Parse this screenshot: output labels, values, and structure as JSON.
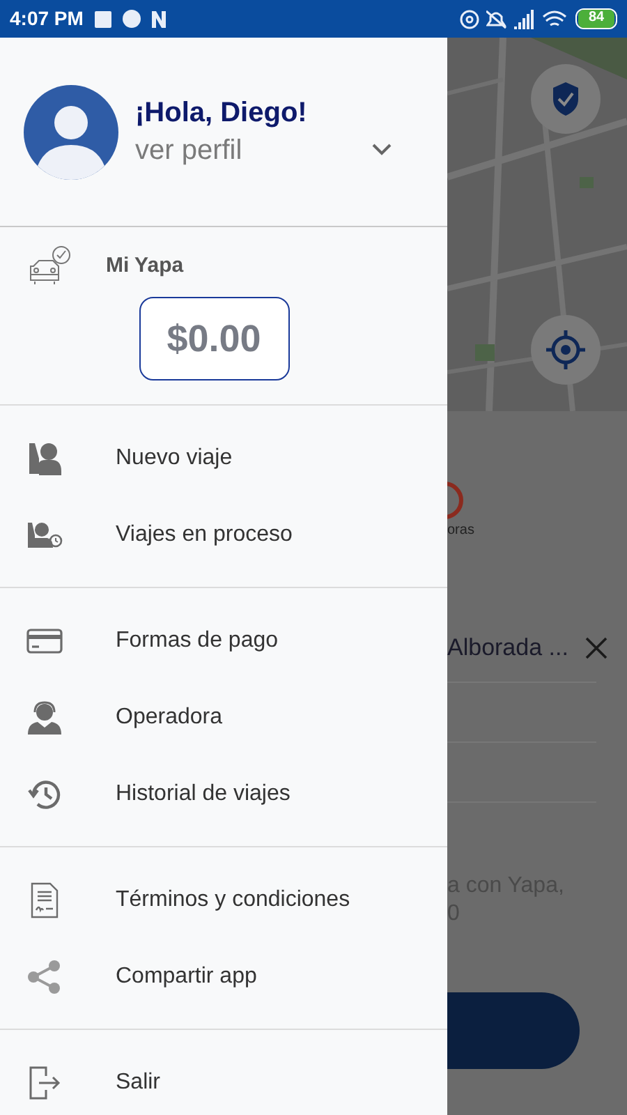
{
  "status_bar": {
    "time": "4:07 PM",
    "battery": "84"
  },
  "drawer": {
    "greeting": "¡Hola, Diego!",
    "profile_link": "ver perfil",
    "wallet": {
      "title": "Mi Yapa",
      "balance": "$0.00"
    },
    "menu_groups": [
      [
        {
          "label": "Nuevo viaje"
        },
        {
          "label": "Viajes en proceso"
        }
      ],
      [
        {
          "label": "Formas de pago"
        },
        {
          "label": "Operadora"
        },
        {
          "label": "Historial de viajes"
        }
      ],
      [
        {
          "label": "Términos y condiciones"
        },
        {
          "label": "Compartir app"
        }
      ],
      [
        {
          "label": "Salir"
        }
      ]
    ]
  },
  "background": {
    "category_label": "oras",
    "destination": "Alborada ...",
    "note_lines": [
      "a con Yapa,",
      "0"
    ]
  }
}
